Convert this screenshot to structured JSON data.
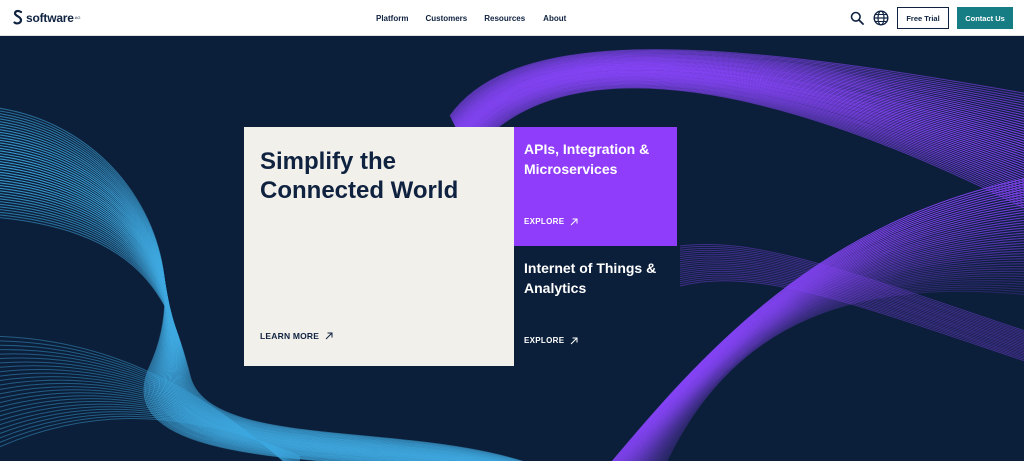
{
  "header": {
    "logo_text": "software",
    "logo_sup": "AG",
    "nav": [
      "Platform",
      "Customers",
      "Resources",
      "About"
    ],
    "search_icon": "search-icon",
    "globe_icon": "globe-icon",
    "free_trial_label": "Free Trial",
    "contact_label": "Contact Us"
  },
  "hero": {
    "main_title": "Simplify the Connected World",
    "learn_more_label": "LEARN MORE",
    "cards": [
      {
        "title": "APIs, Integration & Microservices",
        "explore_label": "EXPLORE"
      },
      {
        "title": "Internet of Things & Analytics",
        "explore_label": "EXPLORE"
      }
    ]
  },
  "colors": {
    "navy": "#0f2240",
    "hero_bg": "#0c1f3a",
    "purple": "#8f3dfa",
    "teal": "#167d85",
    "cream": "#f2f0ea",
    "cyan_lines": "#3fa9e0",
    "purple_lines": "#8b46ff"
  }
}
